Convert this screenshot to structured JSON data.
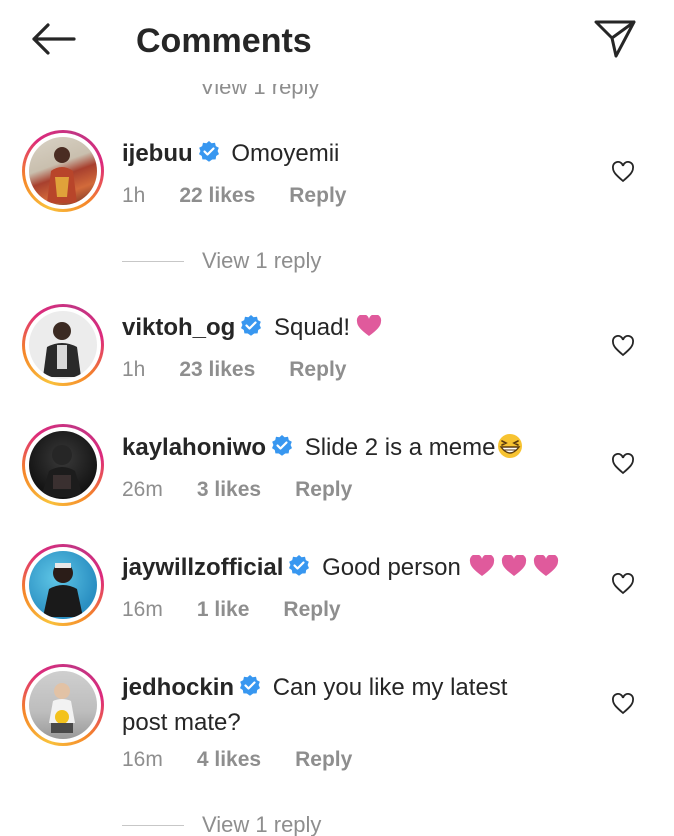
{
  "header": {
    "title": "Comments",
    "back_icon": "arrow-left-icon",
    "share_icon": "paper-plane-icon"
  },
  "top_partial_reply": "View 1 reply",
  "colors": {
    "text": "#262626",
    "muted": "#8e8e8e",
    "verified": "#3897f0",
    "heart_emoji": "#e05a9c"
  },
  "comments": [
    {
      "username": "ijebuu",
      "text": "Omoyemii",
      "time": "1h",
      "likes": "22 likes",
      "reply": "Reply",
      "view_replies": "View 1 reply"
    },
    {
      "username": "viktoh_og",
      "text": "Squad!",
      "time": "1h",
      "likes": "23 likes",
      "reply": "Reply",
      "emoji": "heart"
    },
    {
      "username": "kaylahoniwo",
      "text": "Slide 2 is a meme",
      "time": "26m",
      "likes": "3 likes",
      "reply": "Reply",
      "emoji": "grinning-squinting-face"
    },
    {
      "username": "jaywillzofficial",
      "text": "Good person",
      "time": "16m",
      "likes": "1 like",
      "reply": "Reply",
      "emoji": "three-hearts"
    },
    {
      "username": "jedhockin",
      "text": "Can you like my latest post mate?",
      "time": "16m",
      "likes": "4 likes",
      "reply": "Reply",
      "view_replies": "View 1 reply"
    }
  ]
}
